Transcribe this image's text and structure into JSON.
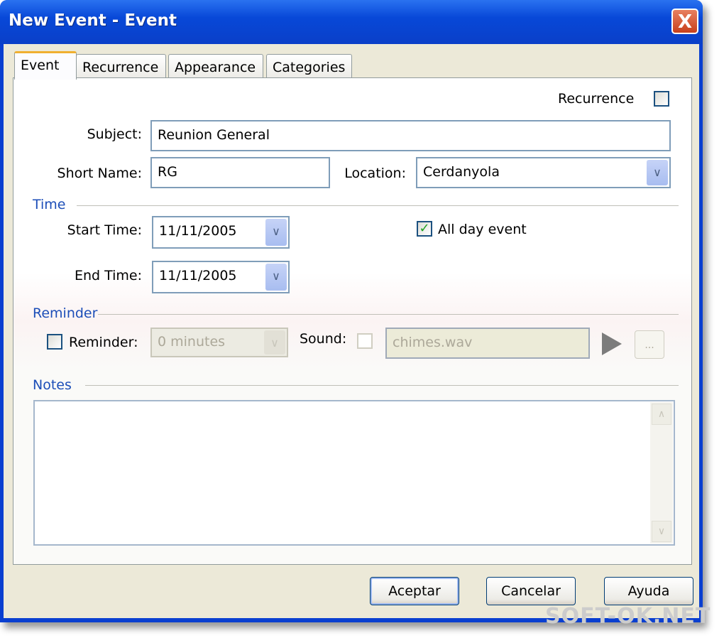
{
  "window": {
    "title": "New Event - Event",
    "close": "X"
  },
  "tabs": [
    "Event",
    "Recurrence",
    "Appearance",
    "Categories"
  ],
  "form": {
    "recurrence_label": "Recurrence",
    "recurrence_checked": false,
    "subject_label": "Subject:",
    "subject_value": "Reunion General",
    "short_name_label": "Short Name:",
    "short_name_value": "RG",
    "location_label": "Location:",
    "location_value": "Cerdanyola",
    "time_section": "Time",
    "start_label": "Start Time:",
    "start_value": "11/11/2005",
    "end_label": "End Time:",
    "end_value": "11/11/2005",
    "all_day_label": "All day event",
    "all_day_checked": true,
    "reminder_section": "Reminder",
    "reminder_label": "Reminder:",
    "reminder_value": "0 minutes",
    "sound_label": "Sound:",
    "sound_value": "chimes.wav",
    "browse": "...",
    "notes_section": "Notes",
    "notes_value": ""
  },
  "buttons": {
    "ok": "Aceptar",
    "cancel": "Cancelar",
    "help": "Ayuda"
  },
  "watermark": "SOFT-OK.NET"
}
